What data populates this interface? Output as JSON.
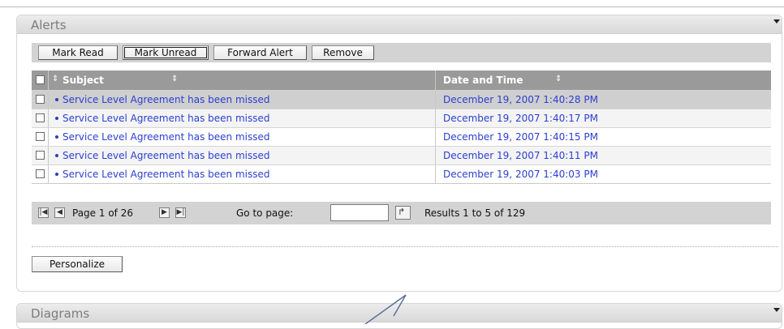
{
  "alerts_panel": {
    "title": "Alerts",
    "toolbar": {
      "mark_read": "Mark Read",
      "mark_unread": "Mark Unread",
      "forward_alert": "Forward Alert",
      "remove": "Remove"
    },
    "columns": {
      "subject": "Subject",
      "date_time": "Date and Time"
    },
    "rows": [
      {
        "subject": "Service Level Agreement has been missed",
        "date": "December 19, 2007 1:40:28 PM"
      },
      {
        "subject": "Service Level Agreement has been missed",
        "date": "December 19, 2007 1:40:17 PM"
      },
      {
        "subject": "Service Level Agreement has been missed",
        "date": "December 19, 2007 1:40:15 PM"
      },
      {
        "subject": "Service Level Agreement has been missed",
        "date": "December 19, 2007 1:40:11 PM"
      },
      {
        "subject": "Service Level Agreement has been missed",
        "date": "December 19, 2007 1:40:03 PM"
      }
    ],
    "pager": {
      "page_info": "Page 1 of 26",
      "go_to_label": "Go to page:",
      "go_to_value": "",
      "results": "Results 1 to 5 of 129"
    },
    "personalize": "Personalize"
  },
  "diagrams_panel": {
    "title": "Diagrams"
  },
  "icons": [
    "first-page-icon",
    "prev-page-icon",
    "next-page-icon",
    "last-page-icon",
    "go-arrow-icon",
    "sort-icon",
    "collapse-icon"
  ],
  "colors": {
    "link": "#2b3fd1",
    "header_bg": "#9a9a9a",
    "toolbar_bg": "#d3d3d3",
    "highlight_row": "#cfcfcf"
  }
}
